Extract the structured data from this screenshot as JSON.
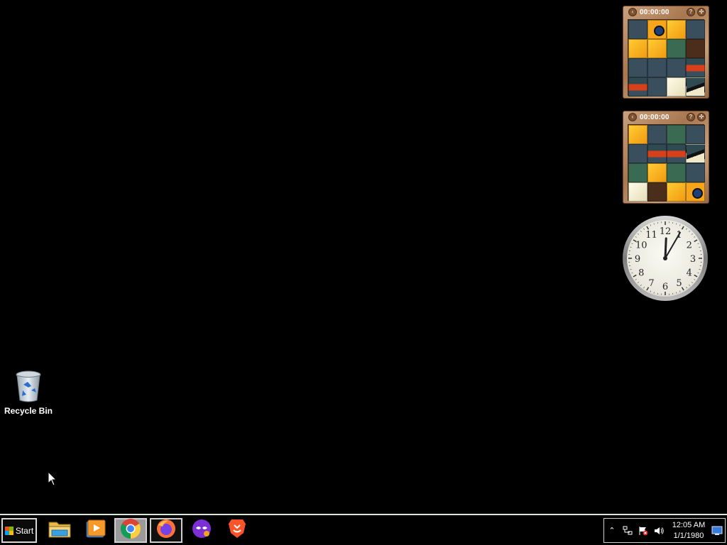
{
  "desktop": {
    "icons": [
      {
        "label": "Recycle Bin",
        "icon": "recycle-bin-icon"
      }
    ]
  },
  "gadgets": {
    "puzzles": [
      {
        "timer": "00:00:00",
        "tiles": [
          "slate",
          "eye",
          "orange",
          "slate",
          "orange",
          "orange",
          "green",
          "brown",
          "slate",
          "slate",
          "slate",
          "red",
          "red",
          "slate",
          "cream",
          "beak"
        ]
      },
      {
        "timer": "00:00:00",
        "tiles": [
          "orange",
          "slate",
          "green",
          "slate",
          "slate",
          "red",
          "red",
          "beak",
          "green",
          "orange",
          "green",
          "slate",
          "cream",
          "brown",
          "orange",
          "eye"
        ]
      }
    ],
    "clock": {
      "numbers": [
        "12",
        "1",
        "2",
        "3",
        "4",
        "5",
        "6",
        "7",
        "8",
        "9",
        "10",
        "11"
      ],
      "hour": 12,
      "minute": 5
    }
  },
  "taskbar": {
    "start_label": "Start",
    "apps": [
      {
        "name": "File Explorer",
        "icon": "file-explorer-icon",
        "state": "normal"
      },
      {
        "name": "Windows Media Player",
        "icon": "media-player-icon",
        "state": "normal"
      },
      {
        "name": "Google Chrome",
        "icon": "chrome-icon",
        "state": "active"
      },
      {
        "name": "Firefox",
        "icon": "firefox-icon",
        "state": "open"
      },
      {
        "name": "Tor Browser",
        "icon": "tor-browser-icon",
        "state": "normal"
      },
      {
        "name": "Brave",
        "icon": "brave-icon",
        "state": "normal"
      }
    ],
    "tray": {
      "icons": [
        "show-hidden-icons-icon",
        "network-icon",
        "action-center-flag-icon",
        "volume-icon"
      ],
      "time": "12:05 AM",
      "date": "1/1/1980",
      "show_desktop_icon": "show-desktop-icon"
    }
  },
  "colors": {
    "desktop_bg": "#000000",
    "taskbar_border": "#d8e6d8",
    "gadget_wood": "#b98a63"
  }
}
